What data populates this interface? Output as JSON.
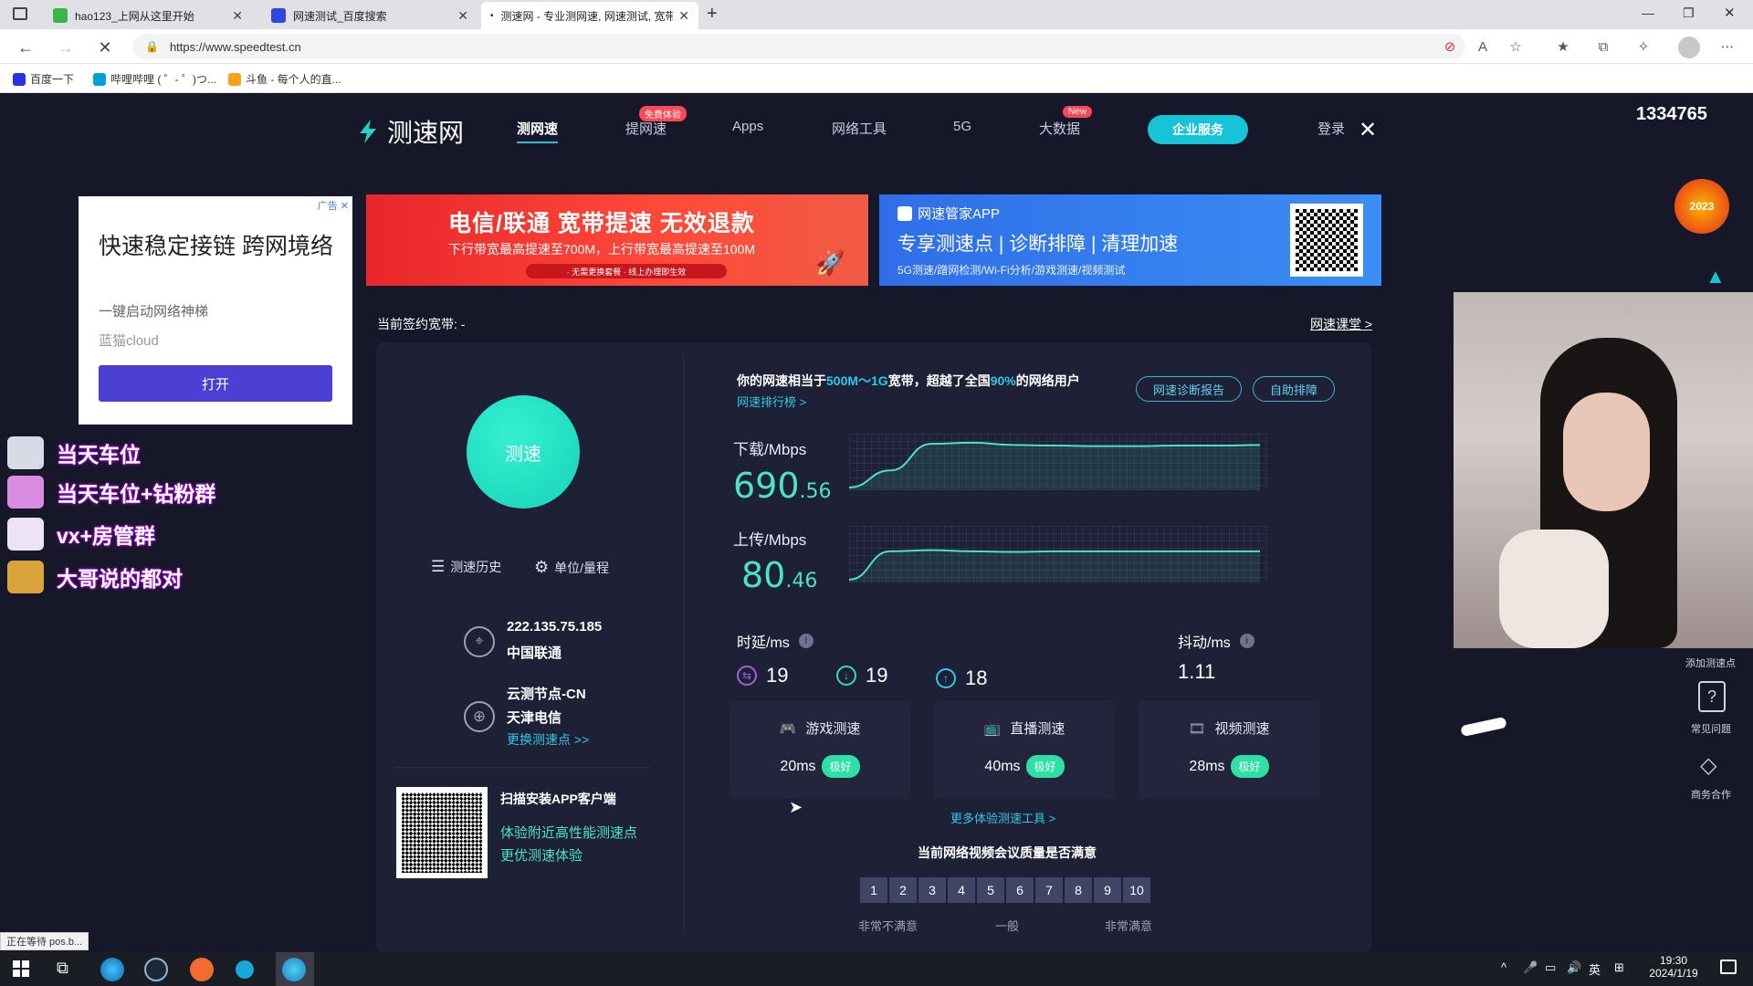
{
  "browser": {
    "tabs": [
      {
        "label": "hao123_上网从这里开始",
        "active": false
      },
      {
        "label": "网速测试_百度搜索",
        "active": false
      },
      {
        "label": "测速网 - 专业测网速, 网速测试, 宽带...",
        "active": true
      }
    ],
    "url": "https://www.speedtest.cn",
    "bookmarks": [
      "百度一下",
      "哔哩哔哩 ( ゜- ゜)つ...",
      "斗鱼 - 每个人的直..."
    ],
    "status_text": "正在等待 pos.b..."
  },
  "nav": {
    "logo": "测速网",
    "items": [
      "测网速",
      "提网速",
      "Apps",
      "网络工具",
      "5G",
      "大数据"
    ],
    "badge_free": "免费体验",
    "badge_new": "New",
    "enterprise": "企业服务",
    "login": "登录"
  },
  "ads": {
    "left": {
      "tag": "广告",
      "title": "快速稳定接链 跨网境络",
      "sub": "一键启动网络神梯",
      "brand": "蓝猫cloud",
      "button": "打开"
    },
    "middle": {
      "title": "电信/联通 宽带提速 无效退款",
      "sub": "下行带宽最高提速至700M，上行带宽最高提速至100M",
      "foot": "· 无需更换套餐  · 线上办理即生效"
    },
    "right": {
      "app": "网速管家APP",
      "title": "专享测速点 | 诊断排障 | 清理加速",
      "sub": "5G测速/蹭网检测/Wi-Fi分析/游戏测速/视频测试"
    }
  },
  "contract": {
    "label": "当前签约宽带:",
    "value": "-",
    "course": "网速课堂 >"
  },
  "left_panel": {
    "speed_btn": "测速",
    "history": "测速历史",
    "unit": "单位/量程",
    "ip": "222.135.75.185",
    "isp": "中国联通",
    "node": "云测节点-CN",
    "node_isp": "天津电信",
    "change_node": "更换测速点 >>",
    "qr_title": "扫描安装APP客户端",
    "qr_line1": "体验附近高性能测速点",
    "qr_line2": "更优测速体验"
  },
  "result": {
    "summary_pre": "你的网速相当于",
    "summary_range": "500M～1G",
    "summary_mid": "宽带，超越了全国",
    "summary_pct": "90%",
    "summary_post": "的网络用户",
    "rank_link": "网速排行榜 >",
    "diag_btn": "网速诊断报告",
    "self_btn": "自助排障",
    "download_label": "下载/Mbps",
    "download_int": "690",
    "download_dec": ".56",
    "upload_label": "上传/Mbps",
    "upload_int": "80",
    "upload_dec": ".46",
    "latency_label": "时延/ms",
    "latency_idle": "19",
    "latency_down": "19",
    "latency_up": "18",
    "jitter_label": "抖动/ms",
    "jitter": "1.11",
    "download_curve": [
      0.05,
      0.35,
      0.82,
      0.84,
      0.8,
      0.79,
      0.78,
      0.78,
      0.79,
      0.79,
      0.8
    ],
    "upload_curve": [
      0.05,
      0.55,
      0.57,
      0.55,
      0.54,
      0.55,
      0.55,
      0.55,
      0.55,
      0.55,
      0.55
    ]
  },
  "tests": [
    {
      "title": "游戏测速",
      "value": "20ms",
      "grade": "极好"
    },
    {
      "title": "直播测速",
      "value": "40ms",
      "grade": "极好"
    },
    {
      "title": "视频测速",
      "value": "28ms",
      "grade": "极好"
    }
  ],
  "more_tools": "更多体验测速工具 >",
  "survey": {
    "question": "当前网络视频会议质量是否满意",
    "scale": [
      "1",
      "2",
      "3",
      "4",
      "5",
      "6",
      "7",
      "8",
      "9",
      "10"
    ],
    "low": "非常不满意",
    "mid": "一般",
    "high": "非常满意"
  },
  "overlay": {
    "viewer_count": "1334765",
    "stream_items": [
      "当天车位",
      "当天车位+钻粉群",
      "vx+房管群",
      "大哥说的都对"
    ],
    "side_items": [
      "添加测速点",
      "常见问题",
      "商务合作"
    ],
    "year_badge": "2023"
  },
  "taskbar": {
    "time": "19:30",
    "date": "2024/1/19",
    "ime": "英"
  },
  "colors": {
    "accent": "#17c3d6",
    "speed": "#4be3c4",
    "good": "#2ee0a6"
  }
}
